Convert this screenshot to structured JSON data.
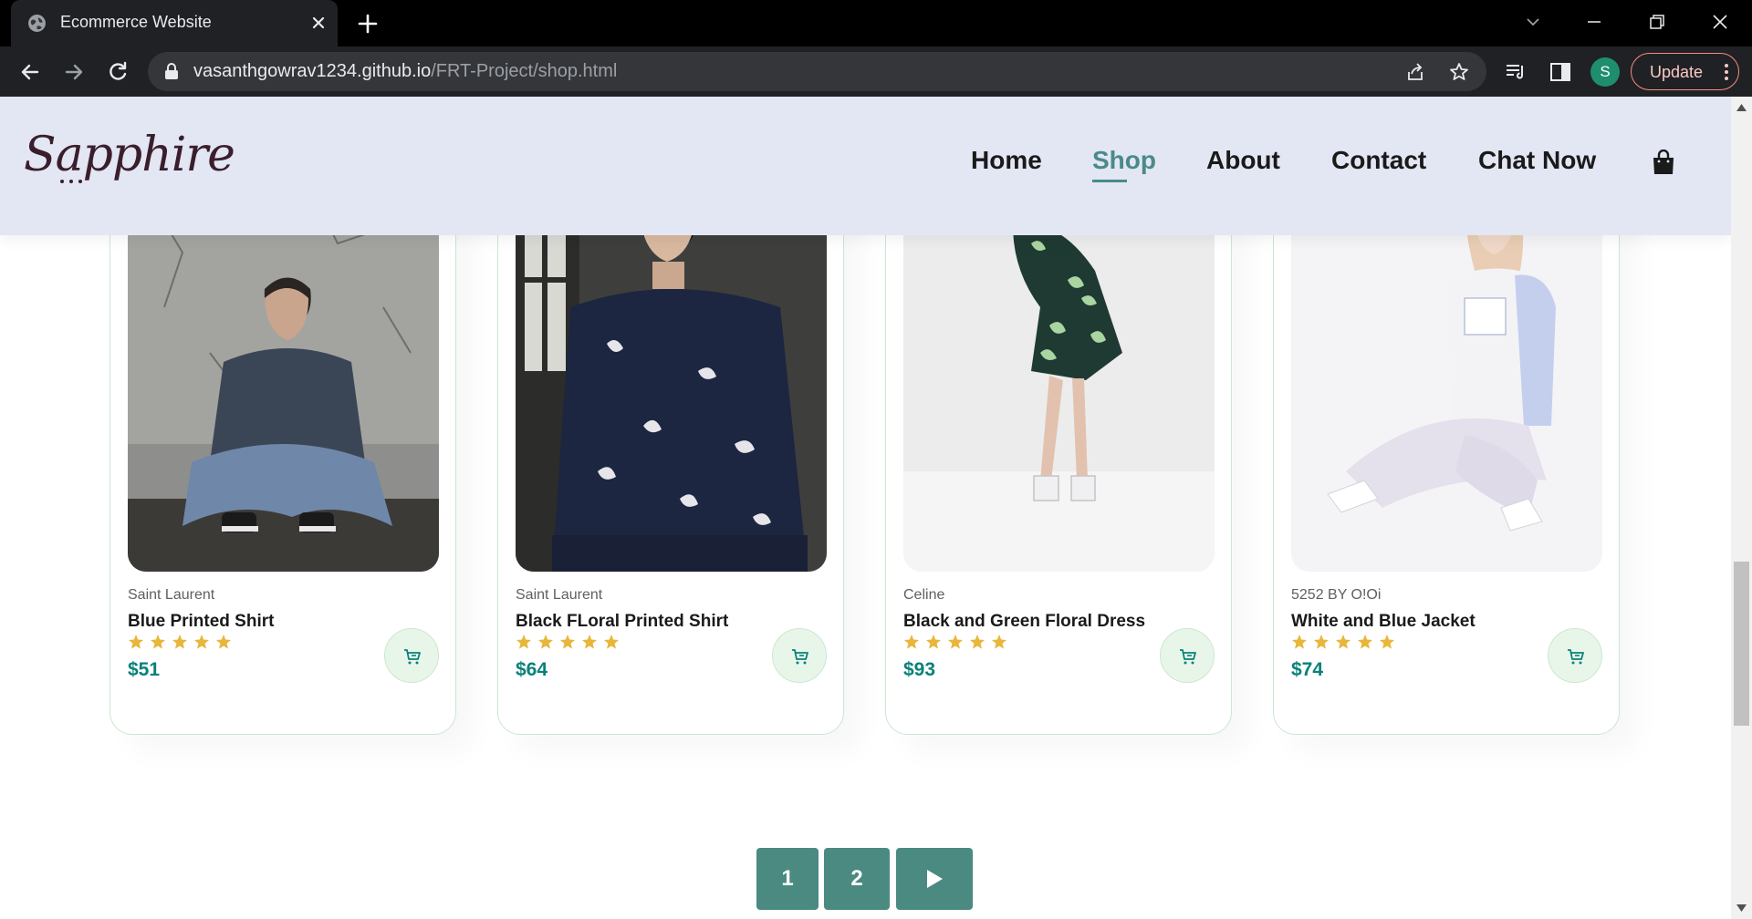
{
  "browser": {
    "tab_title": "Ecommerce Website",
    "url_domain": "vasanthgowrav1234.github.io",
    "url_path": "/FRT-Project/shop.html",
    "profile_initial": "S",
    "update_label": "Update"
  },
  "site": {
    "logo": "Sapphire",
    "nav": {
      "home": "Home",
      "shop": "Shop",
      "about": "About",
      "contact": "Contact",
      "chat": "Chat Now"
    },
    "active_nav": "Shop"
  },
  "products": [
    {
      "brand": "Saint Laurent",
      "name": "Blue Printed Shirt",
      "price": "$51",
      "rating": 5
    },
    {
      "brand": "Saint Laurent",
      "name": "Black FLoral Printed Shirt",
      "price": "$64",
      "rating": 5
    },
    {
      "brand": "Celine",
      "name": "Black and Green Floral Dress",
      "price": "$93",
      "rating": 5
    },
    {
      "brand": "5252 BY O!Oi",
      "name": "White and Blue Jacket",
      "price": "$74",
      "rating": 5
    }
  ],
  "pagination": {
    "page1": "1",
    "page2": "2",
    "next_icon": "play-triangle-icon"
  },
  "colors": {
    "accent": "#4a8a81",
    "star": "#e8b63a",
    "header_bg": "#e3e6f3"
  }
}
